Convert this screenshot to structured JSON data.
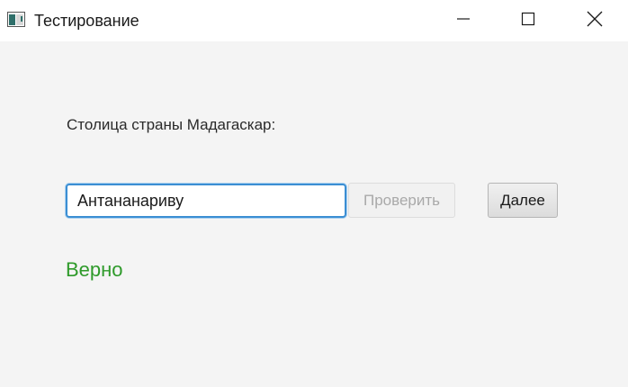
{
  "window": {
    "title": "Тестирование",
    "icon": "app-window-icon",
    "controls": [
      "minimize-icon",
      "maximize-icon",
      "close-icon"
    ]
  },
  "quiz": {
    "question": "Столица страны Мадагаскар:",
    "answer_value": "Антананариву",
    "check_label": "Проверить",
    "check_enabled": false,
    "next_label": "Далее",
    "result_text": "Верно"
  },
  "colors": {
    "result": "#2e9a2a",
    "focus_border": "#3b8ed3",
    "disabled_text": "#a9a9a9"
  }
}
